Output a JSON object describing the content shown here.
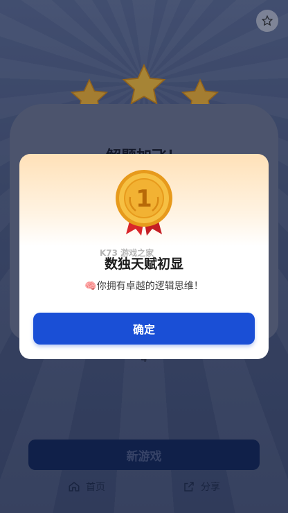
{
  "background": {
    "result_title": "解题加飞！",
    "caption": "4"
  },
  "actions": {
    "new_game_label": "新游戏"
  },
  "nav": {
    "home_label": "首页",
    "share_label": "分享"
  },
  "modal": {
    "medal_rank": "1",
    "watermark": "K73 游戏之家",
    "title": "数独天赋初显",
    "description": "你拥有卓越的逻辑思维！",
    "description_emoji": "🧠",
    "confirm_label": "确定"
  },
  "colors": {
    "primary": "#1a4fd6",
    "medal_gold": "#f2b233",
    "ribbon": "#d9262b"
  }
}
